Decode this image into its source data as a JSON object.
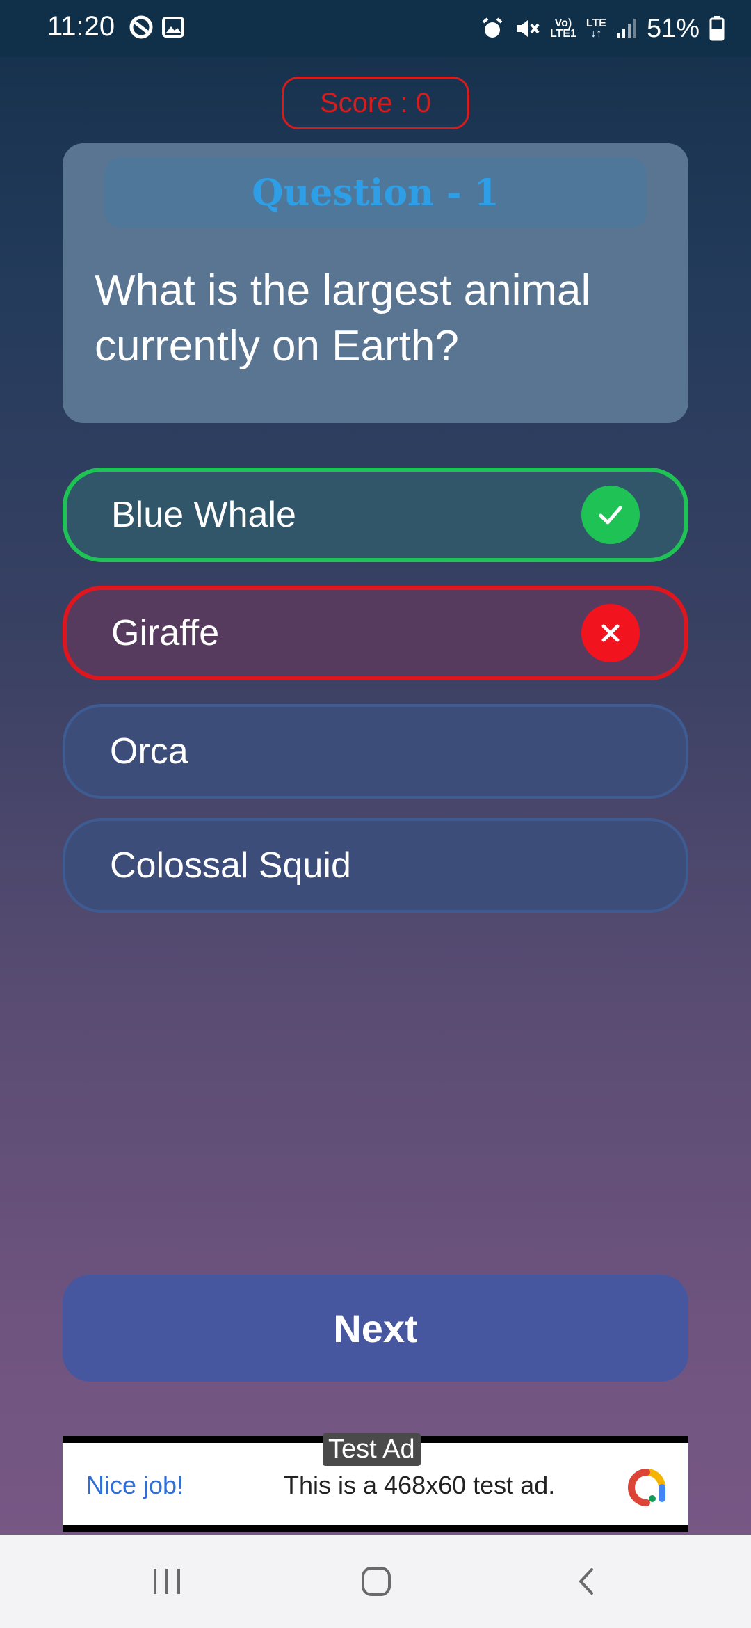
{
  "status_bar": {
    "time": "11:20",
    "battery": "51%",
    "network_label_top": "Vo)",
    "network_label_bottom": "LTE1",
    "lte_label": "LTE"
  },
  "score_label": "Score : 0",
  "question": {
    "header": "Question - 1",
    "text": "What is the largest animal currently on Earth?"
  },
  "options": [
    {
      "label": "Blue Whale",
      "state": "correct"
    },
    {
      "label": "Giraffe",
      "state": "wrong"
    },
    {
      "label": "Orca",
      "state": "default"
    },
    {
      "label": "Colossal Squid",
      "state": "default"
    }
  ],
  "next_label": "Next",
  "ad": {
    "badge": "Test Ad",
    "headline": "Nice job!",
    "text": "This is a 468x60 test ad."
  },
  "colors": {
    "correct": "#1fc254",
    "wrong": "#e0161f",
    "score": "#d51d1d",
    "question_header": "#2e9ee6"
  }
}
